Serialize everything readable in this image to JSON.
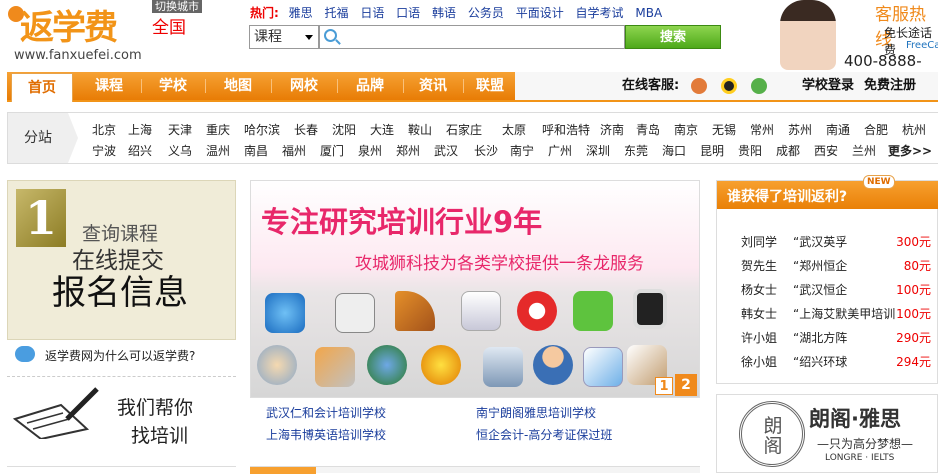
{
  "header": {
    "brand": "返学费",
    "url": "www.fanxuefei.com",
    "city_switch": "切换城市",
    "city": "全国",
    "hot_label": "热门:",
    "hot_keywords": [
      "雅思",
      "托福",
      "日语",
      "口语",
      "韩语",
      "公务员",
      "平面设计",
      "自学考试",
      "MBA"
    ],
    "search": {
      "category": "课程",
      "placeholder": "",
      "button": "搜索"
    },
    "service": {
      "title": "客服热线",
      "line1": "免长途话费",
      "line2": "FreeCall",
      "phone": "400-8888-780"
    }
  },
  "nav": {
    "items": [
      "首页",
      "课程",
      "学校",
      "地图",
      "网校",
      "品牌",
      "资讯",
      "联盟"
    ],
    "online_label": "在线客服:",
    "login": "学校登录",
    "register": "免费注册"
  },
  "subsites": {
    "label": "分站",
    "row1": [
      "北京",
      "上海",
      "天津",
      "重庆",
      "哈尔滨",
      "长春",
      "沈阳",
      "大连",
      "鞍山",
      "石家庄",
      "太原",
      "呼和浩特",
      "济南",
      "青岛",
      "南京",
      "无锡",
      "常州",
      "苏州",
      "南通",
      "合肥",
      "杭州"
    ],
    "row2": [
      "宁波",
      "绍兴",
      "义乌",
      "温州",
      "南昌",
      "福州",
      "厦门",
      "泉州",
      "郑州",
      "武汉",
      "长沙",
      "南宁",
      "广州",
      "深圳",
      "东莞",
      "海口",
      "昆明",
      "贵阳",
      "成都",
      "西安",
      "兰州"
    ],
    "more": "更多>>"
  },
  "promo": {
    "step": "1",
    "line1": "查询课程",
    "line2": "在线提交",
    "line3": "报名信息",
    "why": "返学费网为什么可以返学费?",
    "slogan1": "我们帮你",
    "slogan2": "找培训"
  },
  "banner": {
    "headline": "专注研究培训行业9年",
    "sub": "攻城狮科技为各类学校提供一条龙服务",
    "pages": [
      "1",
      "2"
    ],
    "icons": [
      "ie-icon",
      "document-icon",
      "design-tool-icon",
      "chart-icon",
      "weibo-icon",
      "wechat-icon",
      "tablet-icon",
      "user-admin-icon",
      "tools-icon",
      "group-icon",
      "qq-smiley-icon",
      "contact-card-icon",
      "person-icon",
      "image-icon",
      "paint-brush-icon"
    ],
    "links": [
      "武汉仁和会计培训学校",
      "南宁朗阁雅思培训学校",
      "上海韦博英语培训学校",
      "恒企会计-高分考证保过班"
    ]
  },
  "rebate": {
    "title": "谁获得了培训返利?",
    "badge": "NEW",
    "rows": [
      {
        "name": "刘同学",
        "school": "“武汉英孚",
        "amount": "300元"
      },
      {
        "name": "贺先生",
        "school": "“郑州恒企",
        "amount": "80元"
      },
      {
        "name": "杨女士",
        "school": "“武汉恒企",
        "amount": "100元"
      },
      {
        "name": "韩女士",
        "school": "“上海艾默美甲培训",
        "amount": "100元"
      },
      {
        "name": "许小姐",
        "school": "“湖北方阵",
        "amount": "290元"
      },
      {
        "name": "徐小姐",
        "school": "“绍兴环球",
        "amount": "294元"
      }
    ]
  },
  "longre": {
    "seal_text": "朗阁",
    "name": "朗阁·雅思",
    "motto": "—只为高分梦想—",
    "en": "LONGRE · IELTS"
  },
  "colors": {
    "accent": "#f29418",
    "link": "#1a3d9c",
    "price": "#e00000",
    "banner_text": "#e8276a"
  }
}
